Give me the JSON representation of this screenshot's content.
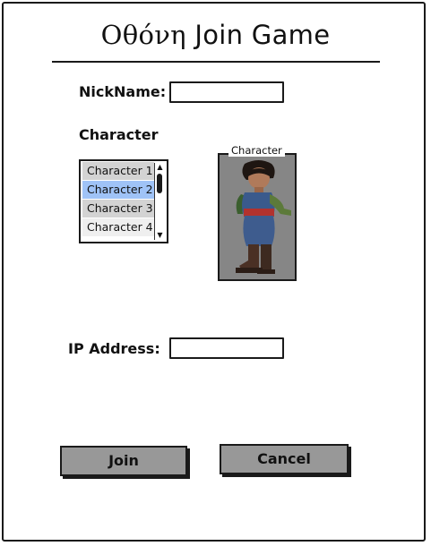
{
  "window": {
    "title_greek": "Οθόνη",
    "title_rest": "Join Game"
  },
  "nickname": {
    "label": "NickName:",
    "value": ""
  },
  "character": {
    "section_label": "Character",
    "list": {
      "items": [
        "Character 1",
        "Character 2",
        "Character 3",
        "Character 4"
      ],
      "selected": "Character 2"
    },
    "preview_label": "Character"
  },
  "ip": {
    "label": "IP Address:",
    "value": ""
  },
  "buttons": {
    "join": "Join",
    "cancel": "Cancel"
  },
  "colors": {
    "selection": "#9fc3f7",
    "button_face": "#989898"
  }
}
